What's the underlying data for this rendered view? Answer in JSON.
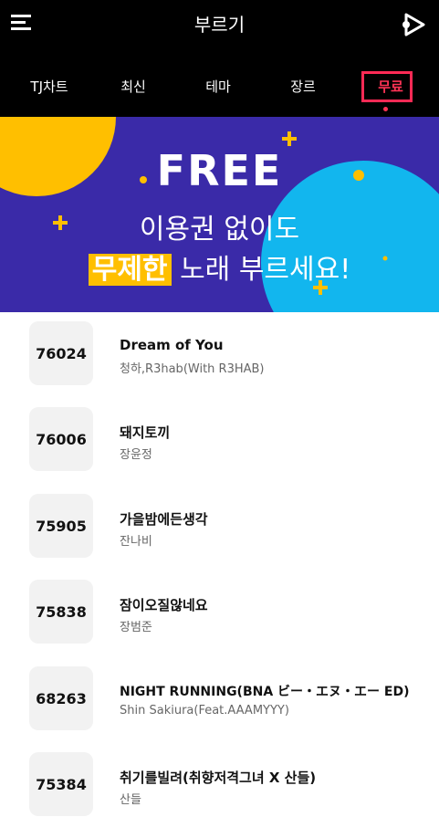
{
  "header": {
    "title": "부르기",
    "menu_icon": "hamburger-menu-icon",
    "play_icon": "play-icon"
  },
  "tabs": [
    {
      "label": "TJ차트",
      "active": false
    },
    {
      "label": "최신",
      "active": false
    },
    {
      "label": "테마",
      "active": false
    },
    {
      "label": "장르",
      "active": false
    },
    {
      "label": "무료",
      "active": true
    }
  ],
  "banner": {
    "title": "FREE",
    "line1": "이용권 없이도",
    "highlight": "무제한",
    "line2_rest": " 노래 부르세요!",
    "colors": {
      "background": "#3a2aa8",
      "yellow": "#ffbf00",
      "cyan": "#12b6ee"
    }
  },
  "songs": [
    {
      "number": "76024",
      "title": "Dream of You",
      "artist": "청하,R3hab(With R3HAB)"
    },
    {
      "number": "76006",
      "title": "돼지토끼",
      "artist": "장윤정"
    },
    {
      "number": "75905",
      "title": "가을밤에든생각",
      "artist": "잔나비"
    },
    {
      "number": "75838",
      "title": "잠이오질않네요",
      "artist": "장범준"
    },
    {
      "number": "68263",
      "title": "NIGHT RUNNING(BNA ビー・エヌ・エー ED)",
      "artist": "Shin Sakiura(Feat.AAAMYYY)"
    },
    {
      "number": "75384",
      "title": "취기를빌려(취향저격그녀 X 산들)",
      "artist": "산들"
    }
  ]
}
